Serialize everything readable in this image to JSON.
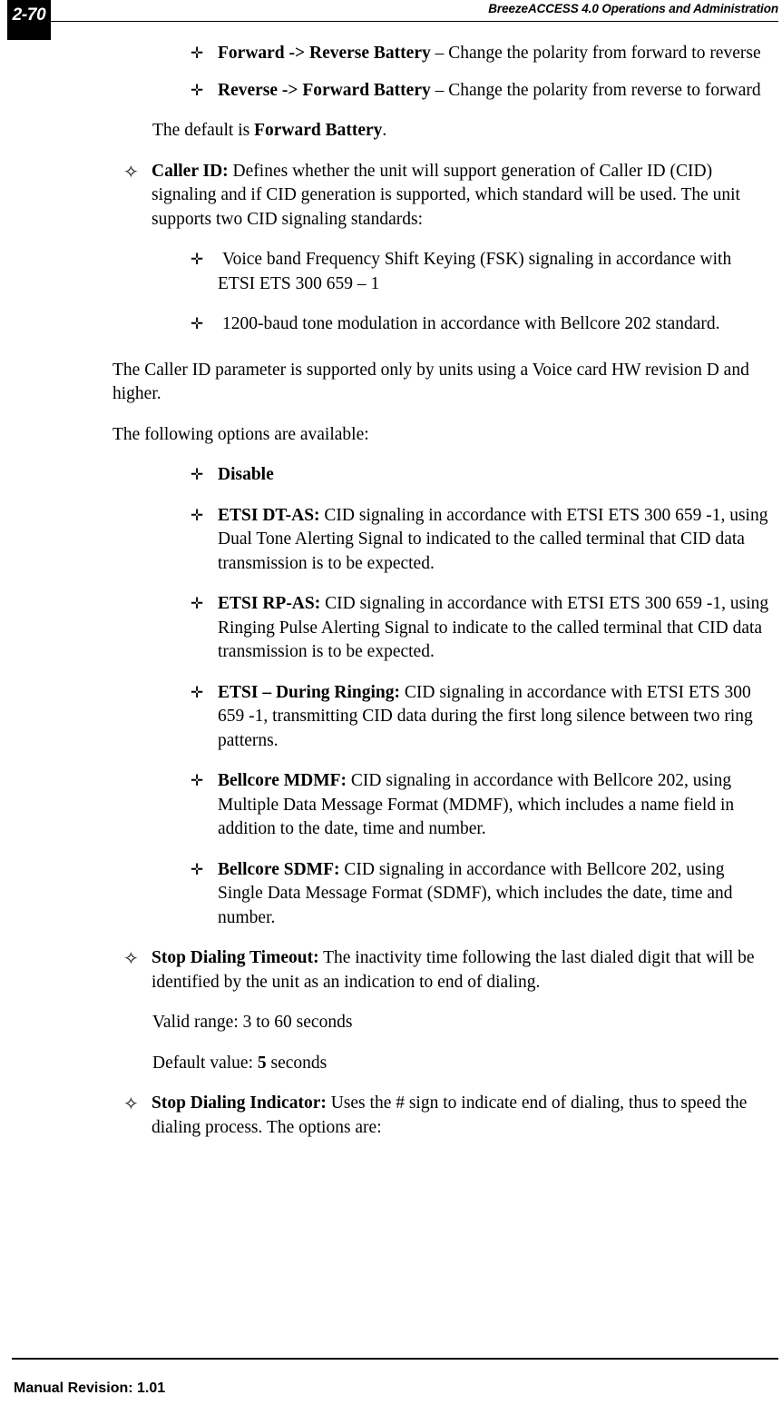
{
  "header": {
    "page_number": "2-70",
    "title": "BreezeACCESS 4.0 Operations and Administration"
  },
  "footer": {
    "revision_label": "Manual Revision: 1.01"
  },
  "icons": {
    "level1_bullet": "four-point-star-bullet",
    "level2_bullet": "cross-clover-bullet",
    "level1_glyph": "✧",
    "level2_glyph": "✛"
  },
  "blocks": [
    {
      "id": "forward-to-reverse-battery",
      "level": 2,
      "bold_lead": "Forward -> Reverse Battery",
      "rest": " – Change the polarity from forward to reverse"
    },
    {
      "id": "reverse-to-forward-battery",
      "level": 2,
      "bold_lead": "Reverse -> Forward Battery",
      "rest": " – Change the polarity from reverse to forward"
    },
    {
      "id": "default-forward-battery",
      "level": "para-l1",
      "pre": "The default is ",
      "bold_mid": "Forward Battery",
      "post": "."
    },
    {
      "id": "caller-id",
      "level": 1,
      "bold_lead": "Caller ID:",
      "rest": " Defines whether the unit will support generation of Caller ID (CID) signaling and if CID generation is supported, which standard will be used. The unit supports two CID signaling standards:"
    },
    {
      "id": "fsk-signaling",
      "level": 2,
      "bold_lead": "",
      "rest": "Voice band Frequency Shift Keying (FSK) signaling in accordance with ETSI ETS 300 659 – 1"
    },
    {
      "id": "bellcore-202-tone",
      "level": 2,
      "bold_lead": "",
      "rest": "1200-baud tone modulation in accordance with Bellcore 202 standard."
    },
    {
      "id": "voice-card-note",
      "level": "para-body",
      "text": "The Caller ID parameter is supported only by units using a Voice card HW revision D and higher."
    },
    {
      "id": "options-available-intro",
      "level": "para-body",
      "text": "The following options are available:"
    },
    {
      "id": "option-disable",
      "level": 2,
      "bold_lead": "Disable",
      "rest": ""
    },
    {
      "id": "option-etsi-dt-as",
      "level": 2,
      "bold_lead": "ETSI DT-AS:",
      "rest": " CID signaling in accordance with ETSI ETS 300 659 -1, using Dual Tone Alerting Signal to indicated to the called terminal that CID data transmission is to be expected."
    },
    {
      "id": "option-etsi-rp-as",
      "level": 2,
      "bold_lead": "ETSI RP-AS:",
      "rest": " CID signaling in accordance with ETSI ETS 300 659 -1, using Ringing Pulse Alerting Signal to indicate to the called terminal that CID data transmission is to be expected."
    },
    {
      "id": "option-etsi-during-ringing",
      "level": 2,
      "bold_lead": "ETSI – During Ringing:",
      "rest": " CID signaling in accordance with ETSI ETS 300 659 -1, transmitting CID data during the first long silence between two ring patterns."
    },
    {
      "id": "option-bellcore-mdmf",
      "level": 2,
      "bold_lead": "Bellcore MDMF:",
      "rest": " CID signaling in accordance with Bellcore 202, using Multiple Data Message Format (MDMF), which includes a name field in addition to the date, time and number."
    },
    {
      "id": "option-bellcore-sdmf",
      "level": 2,
      "bold_lead": "Bellcore SDMF:",
      "rest": " CID signaling in accordance with Bellcore 202, using Single Data Message Format (SDMF), which includes the date, time and number."
    },
    {
      "id": "stop-dialing-timeout",
      "level": 1,
      "bold_lead": "Stop Dialing Timeout:",
      "rest": " The inactivity time following the last dialed digit that will be identified by the unit as an indication to end of dialing."
    },
    {
      "id": "valid-range",
      "level": "para-l1",
      "text": "Valid range: 3 to 60 seconds"
    },
    {
      "id": "default-value",
      "level": "para-l1",
      "pre": "Default value: ",
      "bold_mid": "5",
      "post": " seconds"
    },
    {
      "id": "stop-dialing-indicator",
      "level": 1,
      "bold_lead": "Stop Dialing Indicator:",
      "rest": "  Uses the # sign to indicate end of dialing, thus to speed the dialing process.  The options are:"
    }
  ],
  "text": {
    "forward_reverse_lead": "Forward -> Reverse Battery",
    "forward_reverse_rest": " – Change the polarity from forward to reverse",
    "reverse_forward_lead": "Reverse -> Forward Battery",
    "reverse_forward_rest": " – Change the polarity from reverse to forward",
    "default_pre": "The default is ",
    "default_bold": "Forward Battery",
    "default_post": ".",
    "caller_id_lead": "Caller ID:",
    "caller_id_rest": " Defines whether the unit will support generation of Caller ID (CID) signaling and if CID generation is supported, which standard will be used. The unit supports two CID signaling standards:",
    "fsk_text": "Voice band Frequency Shift Keying (FSK) signaling in accordance with ETSI ETS 300 659 – 1",
    "bellcore_tone_text": "1200-baud tone modulation in accordance with Bellcore 202 standard.",
    "voice_card_note": "The Caller ID parameter is supported only by units using a Voice card HW revision D and higher.",
    "options_intro": "The following options are available:",
    "disable_lead": "Disable",
    "dtas_lead": "ETSI DT-AS:",
    "dtas_rest": " CID signaling in accordance with ETSI ETS 300 659 -1, using Dual Tone Alerting Signal to indicated to the called terminal that CID data transmission is to be expected.",
    "rpas_lead": "ETSI RP-AS:",
    "rpas_rest": " CID signaling in accordance with ETSI ETS 300 659 -1, using Ringing Pulse Alerting Signal to indicate to the called terminal that CID data transmission is to be expected.",
    "during_ringing_lead": "ETSI – During Ringing:",
    "during_ringing_rest": " CID signaling in accordance with ETSI ETS 300 659 -1, transmitting CID data during the first long silence between two ring patterns.",
    "mdmf_lead": "Bellcore MDMF:",
    "mdmf_rest": " CID signaling in accordance with Bellcore 202, using Multiple Data Message Format (MDMF), which includes a name field in addition to the date, time and number.",
    "sdmf_lead": "Bellcore SDMF:",
    "sdmf_rest": " CID signaling in accordance with Bellcore 202, using Single Data Message Format (SDMF), which includes the date, time and number.",
    "stop_timeout_lead": "Stop Dialing Timeout:",
    "stop_timeout_rest": " The inactivity time following the last dialed digit that will be identified by the unit as an indication to end of dialing.",
    "valid_range": "Valid range: 3 to 60 seconds",
    "default_value_pre": "Default value: ",
    "default_value_bold": "5",
    "default_value_post": " seconds",
    "stop_indicator_lead": "Stop Dialing Indicator:",
    "stop_indicator_rest": "  Uses the # sign to indicate end of dialing, thus to speed the dialing process.  The options are:"
  }
}
